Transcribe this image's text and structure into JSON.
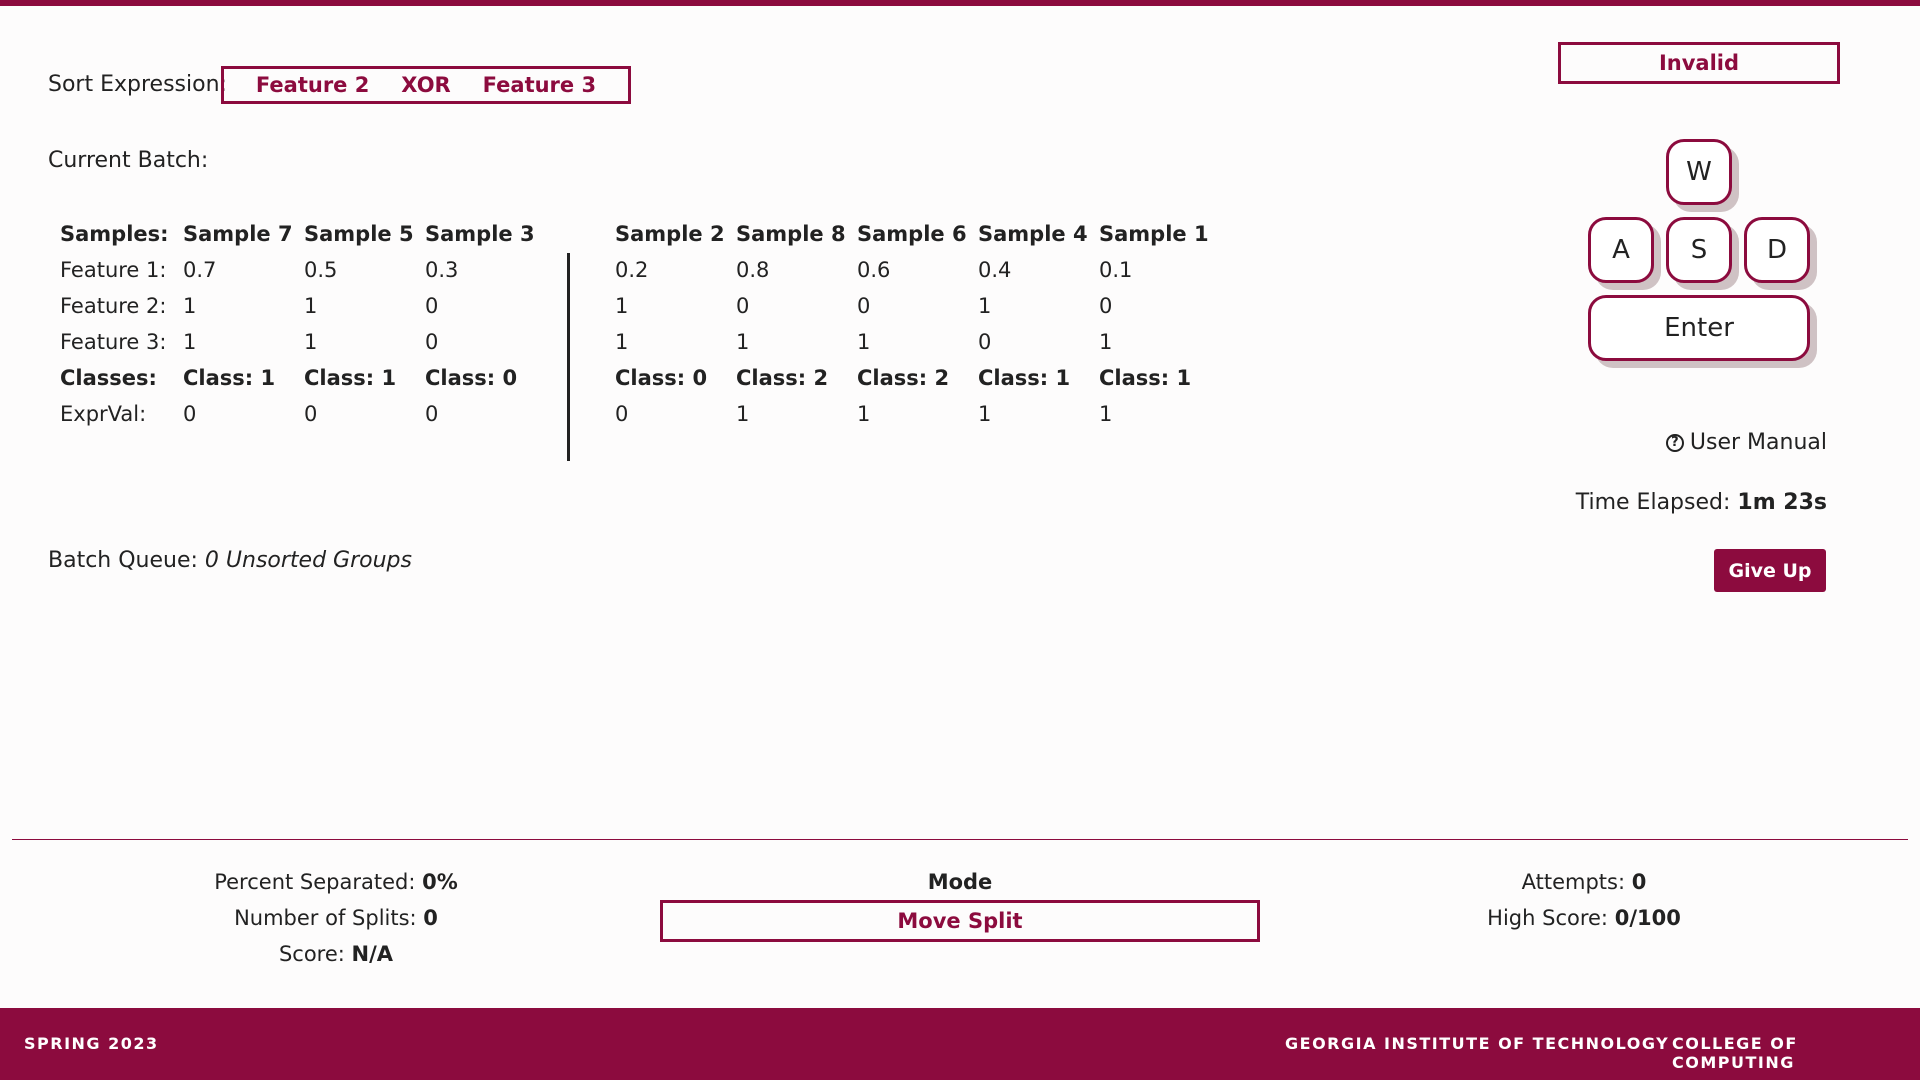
{
  "sort": {
    "label": "Sort Expression:",
    "terms": [
      "Feature 2",
      "XOR",
      "Feature 3"
    ]
  },
  "batch": {
    "label": "Current Batch:",
    "row_labels": [
      "Samples:",
      "Feature 1:",
      "Feature 2:",
      "Feature 3:",
      "Classes:",
      "ExprVal:"
    ],
    "left_group": [
      {
        "name": "Sample 7",
        "f1": "0.7",
        "f2": "1",
        "f3": "1",
        "cls": "Class: 1",
        "expr": "0"
      },
      {
        "name": "Sample 5",
        "f1": "0.5",
        "f2": "1",
        "f3": "1",
        "cls": "Class: 1",
        "expr": "0"
      },
      {
        "name": "Sample 3",
        "f1": "0.3",
        "f2": "0",
        "f3": "0",
        "cls": "Class: 0",
        "expr": "0"
      }
    ],
    "right_group": [
      {
        "name": "Sample 2",
        "f1": "0.2",
        "f2": "1",
        "f3": "1",
        "cls": "Class: 0",
        "expr": "0"
      },
      {
        "name": "Sample 8",
        "f1": "0.8",
        "f2": "0",
        "f3": "1",
        "cls": "Class: 2",
        "expr": "1"
      },
      {
        "name": "Sample 6",
        "f1": "0.6",
        "f2": "0",
        "f3": "1",
        "cls": "Class: 2",
        "expr": "1"
      },
      {
        "name": "Sample 4",
        "f1": "0.4",
        "f2": "1",
        "f3": "0",
        "cls": "Class: 1",
        "expr": "1"
      },
      {
        "name": "Sample 1",
        "f1": "0.1",
        "f2": "0",
        "f3": "1",
        "cls": "Class: 1",
        "expr": "1"
      }
    ]
  },
  "queue": {
    "label": "Batch Queue:",
    "value": "0 Unsorted Groups"
  },
  "status": {
    "invalid": "Invalid"
  },
  "keys": {
    "w": "W",
    "a": "A",
    "s": "S",
    "d": "D",
    "enter": "Enter"
  },
  "manual": {
    "icon": "question-circle-icon",
    "label": "User Manual"
  },
  "time": {
    "label": "Time Elapsed:",
    "value": "1m 23s"
  },
  "give_up": "Give Up",
  "stats_left": {
    "percent_label": "Percent Separated:",
    "percent_value": "0%",
    "splits_label": "Number of Splits:",
    "splits_value": "0",
    "score_label": "Score:",
    "score_value": "N/A"
  },
  "mode": {
    "label": "Mode",
    "value": "Move Split"
  },
  "stats_right": {
    "attempts_label": "Attempts:",
    "attempts_value": "0",
    "high_label": "High Score:",
    "high_value": "0/100"
  },
  "footer": {
    "left": "SPRING 2023",
    "middle": "GEORGIA INSTITUTE OF TECHNOLOGY",
    "right": "COLLEGE OF COMPUTING"
  },
  "colors": {
    "accent": "#8c0b3e",
    "key_shadow": "#cfc2c4"
  }
}
